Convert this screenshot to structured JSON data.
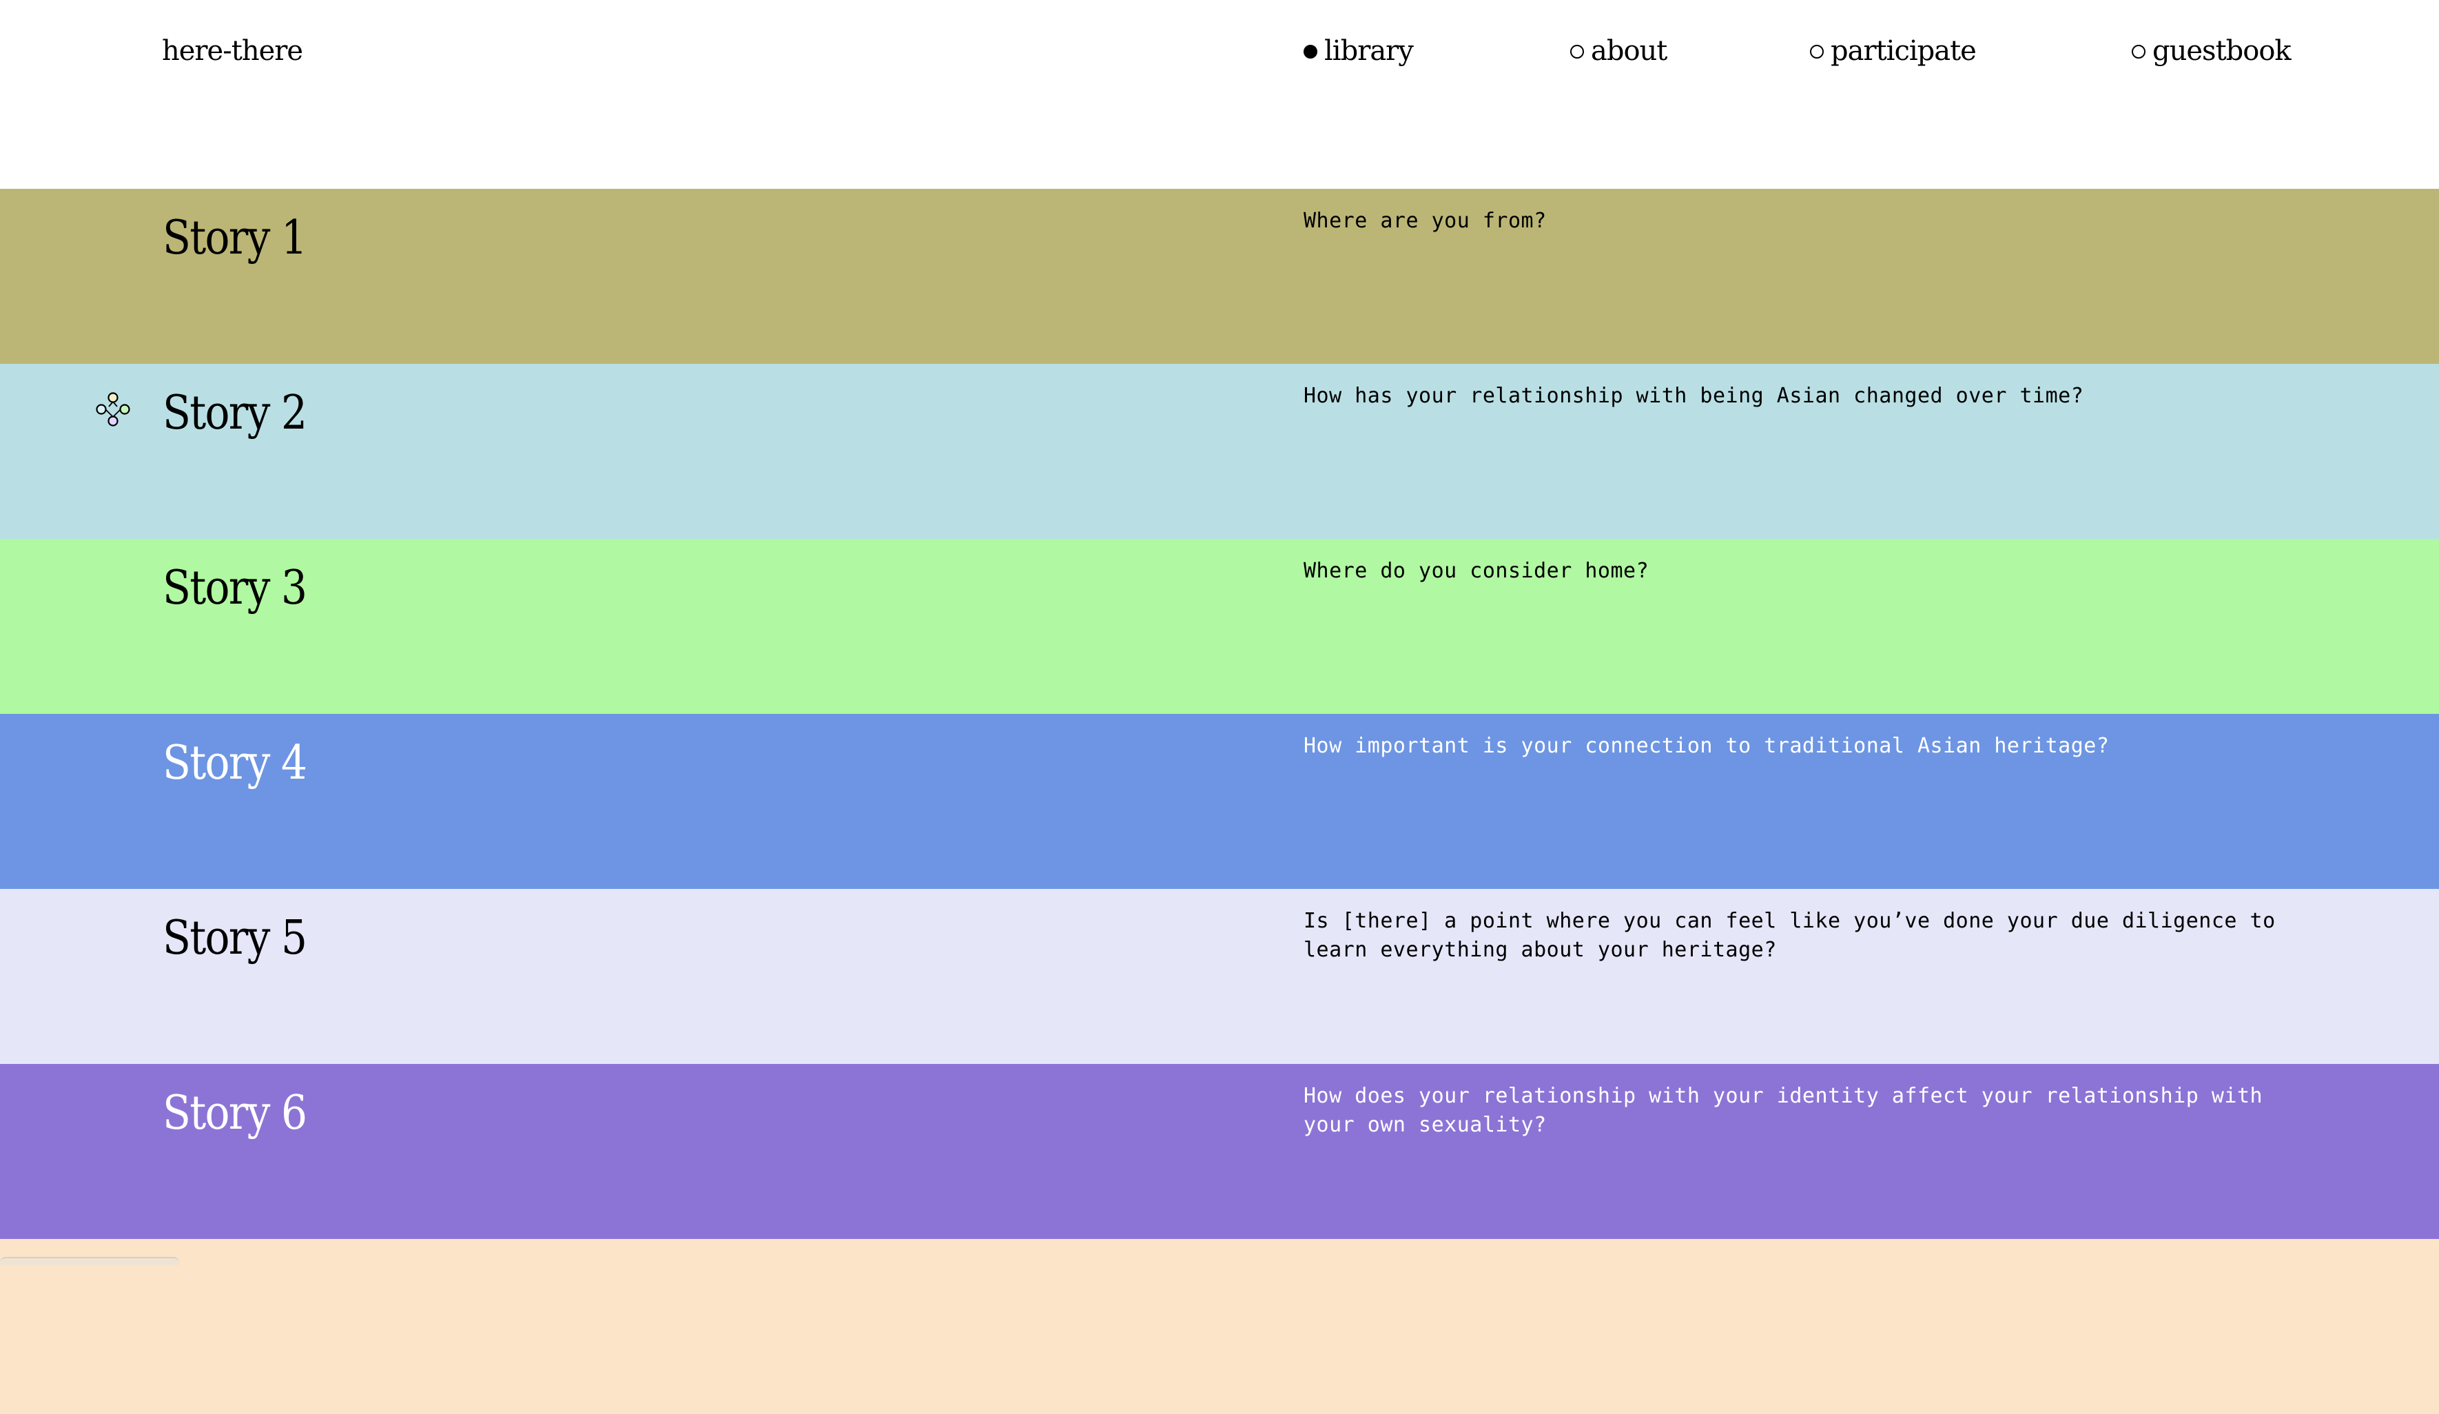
{
  "header": {
    "site_title": "here-there",
    "nav": [
      {
        "label": "library",
        "active": true
      },
      {
        "label": "about",
        "active": false
      },
      {
        "label": "participate",
        "active": false
      },
      {
        "label": "guestbook",
        "active": false
      }
    ]
  },
  "stories": [
    {
      "title": "Story 1",
      "question": "Where are you from?",
      "color": "#bbb676"
    },
    {
      "title": "Story 2",
      "question": "How has your relationship with being Asian changed over time?",
      "color": "#b9dfe4"
    },
    {
      "title": "Story 3",
      "question": "Where do you consider home?",
      "color": "#b0f8a1"
    },
    {
      "title": "Story 4",
      "question": "How important is your connection to traditional Asian heritage?",
      "color": "#6d95e3"
    },
    {
      "title": "Story 5",
      "question": "Is [there] a point where you can feel like you’ve done your due diligence to learn everything about your heritage?",
      "color": "#e5e6f8"
    },
    {
      "title": "Story 6",
      "question": "How does your relationship with your identity affect your relationship with your own sexuality?",
      "color": "#8c74d6"
    },
    {
      "title": "",
      "question": "",
      "color": "#fbe4c8"
    }
  ],
  "icons": {
    "hover_icon": "sparkle-cursor-icon"
  }
}
